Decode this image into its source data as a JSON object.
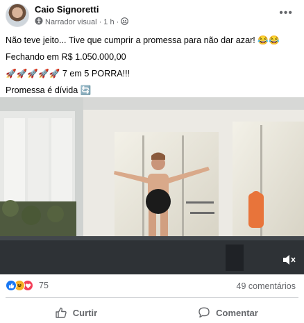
{
  "post": {
    "author": "Caio Signoretti",
    "narrator": "Narrador visual",
    "separator": "·",
    "time": "1 h",
    "separator2": "·",
    "more_icon": "more-dots-icon",
    "lines": [
      "Não teve jeito... Tive que cumprir a promessa para não dar azar! 😂😂",
      "Fechando em R$ 1.050.000,00",
      "🚀🚀🚀🚀🚀 7 em 5 PORRA!!!",
      "Promessa é dívida 🔄"
    ]
  },
  "footer": {
    "reactions": [
      "like",
      "haha",
      "love"
    ],
    "reaction_count": "75",
    "comments": "49 comentários"
  },
  "actions": {
    "like": "Curtir",
    "comment": "Comentar"
  },
  "colors": {
    "accent": "#1877f2",
    "secondary_text": "#65676b"
  }
}
